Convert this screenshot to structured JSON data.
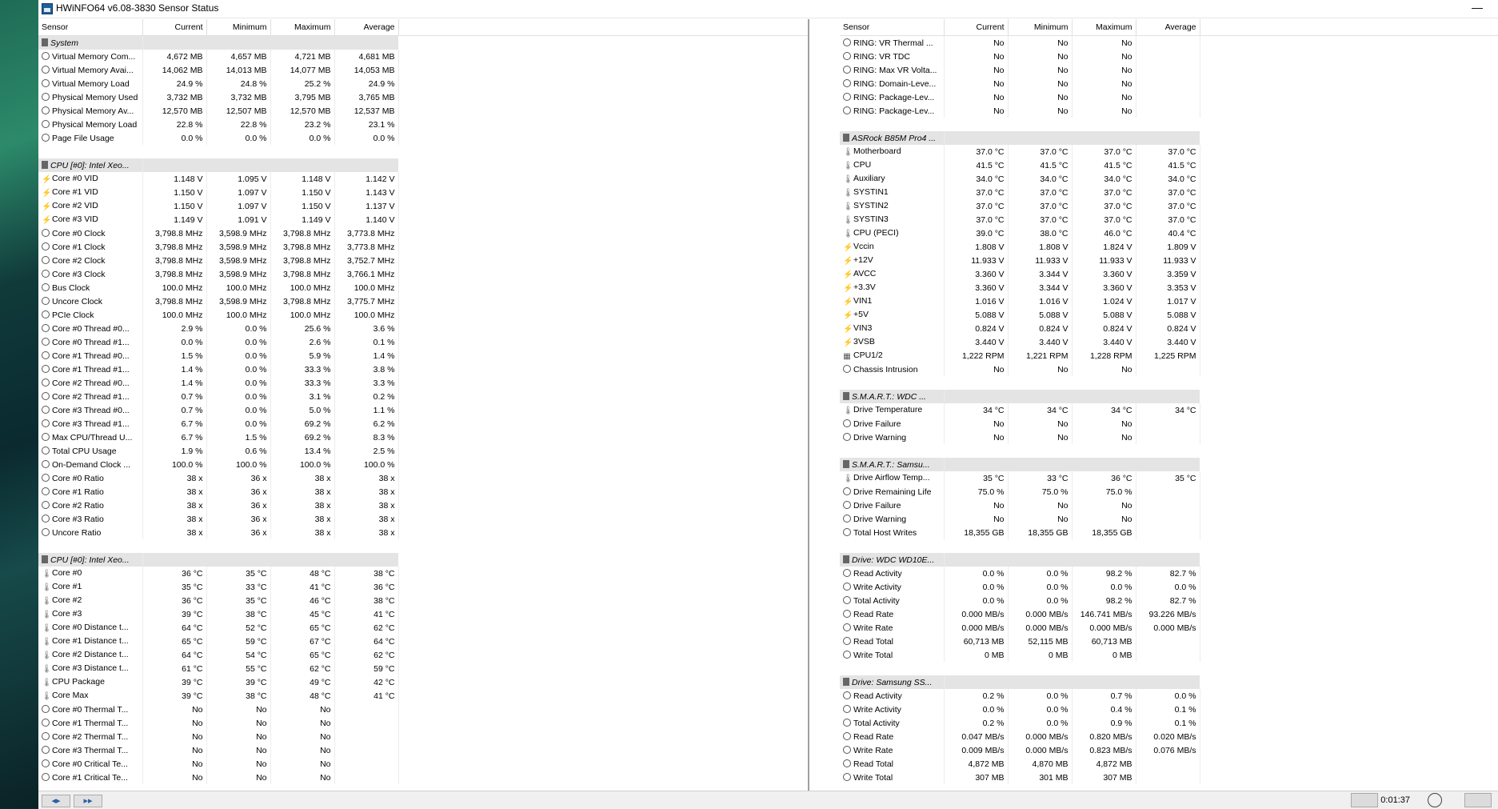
{
  "window": {
    "title": "HWiNFO64 v6.08-3830 Sensor Status",
    "minimize_label": "—"
  },
  "columns": {
    "sensor": "Sensor",
    "current": "Current",
    "minimum": "Minimum",
    "maximum": "Maximum",
    "average": "Average"
  },
  "left_panel": [
    {
      "type": "group",
      "name": "System"
    },
    {
      "type": "row",
      "icon": "clock",
      "name": "Virtual Memory Com...",
      "cur": "4,672 MB",
      "min": "4,657 MB",
      "max": "4,721 MB",
      "avg": "4,681 MB"
    },
    {
      "type": "row",
      "icon": "clock",
      "name": "Virtual Memory Avai...",
      "cur": "14,062 MB",
      "min": "14,013 MB",
      "max": "14,077 MB",
      "avg": "14,053 MB"
    },
    {
      "type": "row",
      "icon": "clock",
      "name": "Virtual Memory Load",
      "cur": "24.9 %",
      "min": "24.8 %",
      "max": "25.2 %",
      "avg": "24.9 %"
    },
    {
      "type": "row",
      "icon": "clock",
      "name": "Physical Memory Used",
      "cur": "3,732 MB",
      "min": "3,732 MB",
      "max": "3,795 MB",
      "avg": "3,765 MB"
    },
    {
      "type": "row",
      "icon": "clock",
      "name": "Physical Memory Av...",
      "cur": "12,570 MB",
      "min": "12,507 MB",
      "max": "12,570 MB",
      "avg": "12,537 MB"
    },
    {
      "type": "row",
      "icon": "clock",
      "name": "Physical Memory Load",
      "cur": "22.8 %",
      "min": "22.8 %",
      "max": "23.2 %",
      "avg": "23.1 %"
    },
    {
      "type": "row",
      "icon": "clock",
      "name": "Page File Usage",
      "cur": "0.0 %",
      "min": "0.0 %",
      "max": "0.0 %",
      "avg": "0.0 %"
    },
    {
      "type": "spacer"
    },
    {
      "type": "group",
      "name": "CPU [#0]: Intel Xeo..."
    },
    {
      "type": "row",
      "icon": "volt",
      "name": "Core #0 VID",
      "cur": "1.148 V",
      "min": "1.095 V",
      "max": "1.148 V",
      "avg": "1.142 V"
    },
    {
      "type": "row",
      "icon": "volt",
      "name": "Core #1 VID",
      "cur": "1.150 V",
      "min": "1.097 V",
      "max": "1.150 V",
      "avg": "1.143 V"
    },
    {
      "type": "row",
      "icon": "volt",
      "name": "Core #2 VID",
      "cur": "1.150 V",
      "min": "1.097 V",
      "max": "1.150 V",
      "avg": "1.137 V"
    },
    {
      "type": "row",
      "icon": "volt",
      "name": "Core #3 VID",
      "cur": "1.149 V",
      "min": "1.091 V",
      "max": "1.149 V",
      "avg": "1.140 V"
    },
    {
      "type": "row",
      "icon": "clock",
      "name": "Core #0 Clock",
      "cur": "3,798.8 MHz",
      "min": "3,598.9 MHz",
      "max": "3,798.8 MHz",
      "avg": "3,773.8 MHz"
    },
    {
      "type": "row",
      "icon": "clock",
      "name": "Core #1 Clock",
      "cur": "3,798.8 MHz",
      "min": "3,598.9 MHz",
      "max": "3,798.8 MHz",
      "avg": "3,773.8 MHz"
    },
    {
      "type": "row",
      "icon": "clock",
      "name": "Core #2 Clock",
      "cur": "3,798.8 MHz",
      "min": "3,598.9 MHz",
      "max": "3,798.8 MHz",
      "avg": "3,752.7 MHz"
    },
    {
      "type": "row",
      "icon": "clock",
      "name": "Core #3 Clock",
      "cur": "3,798.8 MHz",
      "min": "3,598.9 MHz",
      "max": "3,798.8 MHz",
      "avg": "3,766.1 MHz"
    },
    {
      "type": "row",
      "icon": "clock",
      "name": "Bus Clock",
      "cur": "100.0 MHz",
      "min": "100.0 MHz",
      "max": "100.0 MHz",
      "avg": "100.0 MHz"
    },
    {
      "type": "row",
      "icon": "clock",
      "name": "Uncore Clock",
      "cur": "3,798.8 MHz",
      "min": "3,598.9 MHz",
      "max": "3,798.8 MHz",
      "avg": "3,775.7 MHz"
    },
    {
      "type": "row",
      "icon": "clock",
      "name": "PCIe Clock",
      "cur": "100.0 MHz",
      "min": "100.0 MHz",
      "max": "100.0 MHz",
      "avg": "100.0 MHz"
    },
    {
      "type": "row",
      "icon": "clock",
      "name": "Core #0 Thread #0...",
      "cur": "2.9 %",
      "min": "0.0 %",
      "max": "25.6 %",
      "avg": "3.6 %"
    },
    {
      "type": "row",
      "icon": "clock",
      "name": "Core #0 Thread #1...",
      "cur": "0.0 %",
      "min": "0.0 %",
      "max": "2.6 %",
      "avg": "0.1 %"
    },
    {
      "type": "row",
      "icon": "clock",
      "name": "Core #1 Thread #0...",
      "cur": "1.5 %",
      "min": "0.0 %",
      "max": "5.9 %",
      "avg": "1.4 %"
    },
    {
      "type": "row",
      "icon": "clock",
      "name": "Core #1 Thread #1...",
      "cur": "1.4 %",
      "min": "0.0 %",
      "max": "33.3 %",
      "avg": "3.8 %"
    },
    {
      "type": "row",
      "icon": "clock",
      "name": "Core #2 Thread #0...",
      "cur": "1.4 %",
      "min": "0.0 %",
      "max": "33.3 %",
      "avg": "3.3 %"
    },
    {
      "type": "row",
      "icon": "clock",
      "name": "Core #2 Thread #1...",
      "cur": "0.7 %",
      "min": "0.0 %",
      "max": "3.1 %",
      "avg": "0.2 %"
    },
    {
      "type": "row",
      "icon": "clock",
      "name": "Core #3 Thread #0...",
      "cur": "0.7 %",
      "min": "0.0 %",
      "max": "5.0 %",
      "avg": "1.1 %"
    },
    {
      "type": "row",
      "icon": "clock",
      "name": "Core #3 Thread #1...",
      "cur": "6.7 %",
      "min": "0.0 %",
      "max": "69.2 %",
      "avg": "6.2 %"
    },
    {
      "type": "row",
      "icon": "clock",
      "name": "Max CPU/Thread U...",
      "cur": "6.7 %",
      "min": "1.5 %",
      "max": "69.2 %",
      "avg": "8.3 %"
    },
    {
      "type": "row",
      "icon": "clock",
      "name": "Total CPU Usage",
      "cur": "1.9 %",
      "min": "0.6 %",
      "max": "13.4 %",
      "avg": "2.5 %"
    },
    {
      "type": "row",
      "icon": "clock",
      "name": "On-Demand Clock ...",
      "cur": "100.0 %",
      "min": "100.0 %",
      "max": "100.0 %",
      "avg": "100.0 %"
    },
    {
      "type": "row",
      "icon": "clock",
      "name": "Core #0 Ratio",
      "cur": "38 x",
      "min": "36 x",
      "max": "38 x",
      "avg": "38 x"
    },
    {
      "type": "row",
      "icon": "clock",
      "name": "Core #1 Ratio",
      "cur": "38 x",
      "min": "36 x",
      "max": "38 x",
      "avg": "38 x"
    },
    {
      "type": "row",
      "icon": "clock",
      "name": "Core #2 Ratio",
      "cur": "38 x",
      "min": "36 x",
      "max": "38 x",
      "avg": "38 x"
    },
    {
      "type": "row",
      "icon": "clock",
      "name": "Core #3 Ratio",
      "cur": "38 x",
      "min": "36 x",
      "max": "38 x",
      "avg": "38 x"
    },
    {
      "type": "row",
      "icon": "clock",
      "name": "Uncore Ratio",
      "cur": "38 x",
      "min": "36 x",
      "max": "38 x",
      "avg": "38 x"
    },
    {
      "type": "spacer"
    },
    {
      "type": "group",
      "name": "CPU [#0]: Intel Xeo..."
    },
    {
      "type": "row",
      "icon": "temp",
      "name": "Core #0",
      "cur": "36 °C",
      "min": "35 °C",
      "max": "48 °C",
      "avg": "38 °C"
    },
    {
      "type": "row",
      "icon": "temp",
      "name": "Core #1",
      "cur": "35 °C",
      "min": "33 °C",
      "max": "41 °C",
      "avg": "36 °C"
    },
    {
      "type": "row",
      "icon": "temp",
      "name": "Core #2",
      "cur": "36 °C",
      "min": "35 °C",
      "max": "46 °C",
      "avg": "38 °C"
    },
    {
      "type": "row",
      "icon": "temp",
      "name": "Core #3",
      "cur": "39 °C",
      "min": "38 °C",
      "max": "45 °C",
      "avg": "41 °C"
    },
    {
      "type": "row",
      "icon": "temp",
      "name": "Core #0 Distance t...",
      "cur": "64 °C",
      "min": "52 °C",
      "max": "65 °C",
      "avg": "62 °C"
    },
    {
      "type": "row",
      "icon": "temp",
      "name": "Core #1 Distance t...",
      "cur": "65 °C",
      "min": "59 °C",
      "max": "67 °C",
      "avg": "64 °C"
    },
    {
      "type": "row",
      "icon": "temp",
      "name": "Core #2 Distance t...",
      "cur": "64 °C",
      "min": "54 °C",
      "max": "65 °C",
      "avg": "62 °C"
    },
    {
      "type": "row",
      "icon": "temp",
      "name": "Core #3 Distance t...",
      "cur": "61 °C",
      "min": "55 °C",
      "max": "62 °C",
      "avg": "59 °C"
    },
    {
      "type": "row",
      "icon": "temp",
      "name": "CPU Package",
      "cur": "39 °C",
      "min": "39 °C",
      "max": "49 °C",
      "avg": "42 °C"
    },
    {
      "type": "row",
      "icon": "temp",
      "name": "Core Max",
      "cur": "39 °C",
      "min": "38 °C",
      "max": "48 °C",
      "avg": "41 °C"
    },
    {
      "type": "row",
      "icon": "clock",
      "name": "Core #0 Thermal T...",
      "cur": "No",
      "min": "No",
      "max": "No",
      "avg": ""
    },
    {
      "type": "row",
      "icon": "clock",
      "name": "Core #1 Thermal T...",
      "cur": "No",
      "min": "No",
      "max": "No",
      "avg": ""
    },
    {
      "type": "row",
      "icon": "clock",
      "name": "Core #2 Thermal T...",
      "cur": "No",
      "min": "No",
      "max": "No",
      "avg": ""
    },
    {
      "type": "row",
      "icon": "clock",
      "name": "Core #3 Thermal T...",
      "cur": "No",
      "min": "No",
      "max": "No",
      "avg": ""
    },
    {
      "type": "row",
      "icon": "clock",
      "name": "Core #0 Critical Te...",
      "cur": "No",
      "min": "No",
      "max": "No",
      "avg": ""
    },
    {
      "type": "row",
      "icon": "clock",
      "name": "Core #1 Critical Te...",
      "cur": "No",
      "min": "No",
      "max": "No",
      "avg": ""
    }
  ],
  "right_panel": [
    {
      "type": "row",
      "icon": "clock",
      "name": "RING: VR Thermal ...",
      "cur": "No",
      "min": "No",
      "max": "No",
      "avg": ""
    },
    {
      "type": "row",
      "icon": "clock",
      "name": "RING: VR TDC",
      "cur": "No",
      "min": "No",
      "max": "No",
      "avg": ""
    },
    {
      "type": "row",
      "icon": "clock",
      "name": "RING: Max VR Volta...",
      "cur": "No",
      "min": "No",
      "max": "No",
      "avg": ""
    },
    {
      "type": "row",
      "icon": "clock",
      "name": "RING: Domain-Leve...",
      "cur": "No",
      "min": "No",
      "max": "No",
      "avg": ""
    },
    {
      "type": "row",
      "icon": "clock",
      "name": "RING: Package-Lev...",
      "cur": "No",
      "min": "No",
      "max": "No",
      "avg": ""
    },
    {
      "type": "row",
      "icon": "clock",
      "name": "RING: Package-Lev...",
      "cur": "No",
      "min": "No",
      "max": "No",
      "avg": ""
    },
    {
      "type": "spacer"
    },
    {
      "type": "group",
      "name": "ASRock B85M Pro4 ..."
    },
    {
      "type": "row",
      "icon": "temp",
      "name": "Motherboard",
      "cur": "37.0 °C",
      "min": "37.0 °C",
      "max": "37.0 °C",
      "avg": "37.0 °C"
    },
    {
      "type": "row",
      "icon": "temp",
      "name": "CPU",
      "cur": "41.5 °C",
      "min": "41.5 °C",
      "max": "41.5 °C",
      "avg": "41.5 °C"
    },
    {
      "type": "row",
      "icon": "temp",
      "name": "Auxiliary",
      "cur": "34.0 °C",
      "min": "34.0 °C",
      "max": "34.0 °C",
      "avg": "34.0 °C"
    },
    {
      "type": "row",
      "icon": "temp",
      "name": "SYSTIN1",
      "cur": "37.0 °C",
      "min": "37.0 °C",
      "max": "37.0 °C",
      "avg": "37.0 °C"
    },
    {
      "type": "row",
      "icon": "temp",
      "name": "SYSTIN2",
      "cur": "37.0 °C",
      "min": "37.0 °C",
      "max": "37.0 °C",
      "avg": "37.0 °C"
    },
    {
      "type": "row",
      "icon": "temp",
      "name": "SYSTIN3",
      "cur": "37.0 °C",
      "min": "37.0 °C",
      "max": "37.0 °C",
      "avg": "37.0 °C"
    },
    {
      "type": "row",
      "icon": "temp",
      "name": "CPU (PECI)",
      "cur": "39.0 °C",
      "min": "38.0 °C",
      "max": "46.0 °C",
      "avg": "40.4 °C"
    },
    {
      "type": "row",
      "icon": "volt",
      "name": "Vccin",
      "cur": "1.808 V",
      "min": "1.808 V",
      "max": "1.824 V",
      "avg": "1.809 V"
    },
    {
      "type": "row",
      "icon": "volt",
      "name": "+12V",
      "cur": "11.933 V",
      "min": "11.933 V",
      "max": "11.933 V",
      "avg": "11.933 V"
    },
    {
      "type": "row",
      "icon": "volt",
      "name": "AVCC",
      "cur": "3.360 V",
      "min": "3.344 V",
      "max": "3.360 V",
      "avg": "3.359 V"
    },
    {
      "type": "row",
      "icon": "volt",
      "name": "+3.3V",
      "cur": "3.360 V",
      "min": "3.344 V",
      "max": "3.360 V",
      "avg": "3.353 V"
    },
    {
      "type": "row",
      "icon": "volt",
      "name": "VIN1",
      "cur": "1.016 V",
      "min": "1.016 V",
      "max": "1.024 V",
      "avg": "1.017 V"
    },
    {
      "type": "row",
      "icon": "volt",
      "name": "+5V",
      "cur": "5.088 V",
      "min": "5.088 V",
      "max": "5.088 V",
      "avg": "5.088 V"
    },
    {
      "type": "row",
      "icon": "volt",
      "name": "VIN3",
      "cur": "0.824 V",
      "min": "0.824 V",
      "max": "0.824 V",
      "avg": "0.824 V"
    },
    {
      "type": "row",
      "icon": "volt",
      "name": "3VSB",
      "cur": "3.440 V",
      "min": "3.440 V",
      "max": "3.440 V",
      "avg": "3.440 V"
    },
    {
      "type": "row",
      "icon": "fan",
      "name": "CPU1/2",
      "cur": "1,222 RPM",
      "min": "1,221 RPM",
      "max": "1,228 RPM",
      "avg": "1,225 RPM"
    },
    {
      "type": "row",
      "icon": "clock",
      "name": "Chassis Intrusion",
      "cur": "No",
      "min": "No",
      "max": "No",
      "avg": ""
    },
    {
      "type": "spacer"
    },
    {
      "type": "group",
      "name": "S.M.A.R.T.: WDC ..."
    },
    {
      "type": "row",
      "icon": "temp",
      "name": "Drive Temperature",
      "cur": "34 °C",
      "min": "34 °C",
      "max": "34 °C",
      "avg": "34 °C"
    },
    {
      "type": "row",
      "icon": "clock",
      "name": "Drive Failure",
      "cur": "No",
      "min": "No",
      "max": "No",
      "avg": ""
    },
    {
      "type": "row",
      "icon": "clock",
      "name": "Drive Warning",
      "cur": "No",
      "min": "No",
      "max": "No",
      "avg": ""
    },
    {
      "type": "spacer"
    },
    {
      "type": "group",
      "name": "S.M.A.R.T.: Samsu..."
    },
    {
      "type": "row",
      "icon": "temp",
      "name": "Drive Airflow Temp...",
      "cur": "35 °C",
      "min": "33 °C",
      "max": "36 °C",
      "avg": "35 °C"
    },
    {
      "type": "row",
      "icon": "clock",
      "name": "Drive Remaining Life",
      "cur": "75.0 %",
      "min": "75.0 %",
      "max": "75.0 %",
      "avg": ""
    },
    {
      "type": "row",
      "icon": "clock",
      "name": "Drive Failure",
      "cur": "No",
      "min": "No",
      "max": "No",
      "avg": ""
    },
    {
      "type": "row",
      "icon": "clock",
      "name": "Drive Warning",
      "cur": "No",
      "min": "No",
      "max": "No",
      "avg": ""
    },
    {
      "type": "row",
      "icon": "clock",
      "name": "Total Host Writes",
      "cur": "18,355 GB",
      "min": "18,355 GB",
      "max": "18,355 GB",
      "avg": ""
    },
    {
      "type": "spacer"
    },
    {
      "type": "group",
      "name": "Drive: WDC WD10E..."
    },
    {
      "type": "row",
      "icon": "clock",
      "name": "Read Activity",
      "cur": "0.0 %",
      "min": "0.0 %",
      "max": "98.2 %",
      "avg": "82.7 %"
    },
    {
      "type": "row",
      "icon": "clock",
      "name": "Write Activity",
      "cur": "0.0 %",
      "min": "0.0 %",
      "max": "0.0 %",
      "avg": "0.0 %"
    },
    {
      "type": "row",
      "icon": "clock",
      "name": "Total Activity",
      "cur": "0.0 %",
      "min": "0.0 %",
      "max": "98.2 %",
      "avg": "82.7 %"
    },
    {
      "type": "row",
      "icon": "clock",
      "name": "Read Rate",
      "cur": "0.000 MB/s",
      "min": "0.000 MB/s",
      "max": "146.741 MB/s",
      "avg": "93.226 MB/s"
    },
    {
      "type": "row",
      "icon": "clock",
      "name": "Write Rate",
      "cur": "0.000 MB/s",
      "min": "0.000 MB/s",
      "max": "0.000 MB/s",
      "avg": "0.000 MB/s"
    },
    {
      "type": "row",
      "icon": "clock",
      "name": "Read Total",
      "cur": "60,713 MB",
      "min": "52,115 MB",
      "max": "60,713 MB",
      "avg": ""
    },
    {
      "type": "row",
      "icon": "clock",
      "name": "Write Total",
      "cur": "0 MB",
      "min": "0 MB",
      "max": "0 MB",
      "avg": ""
    },
    {
      "type": "spacer"
    },
    {
      "type": "group",
      "name": "Drive: Samsung SS..."
    },
    {
      "type": "row",
      "icon": "clock",
      "name": "Read Activity",
      "cur": "0.2 %",
      "min": "0.0 %",
      "max": "0.7 %",
      "avg": "0.0 %"
    },
    {
      "type": "row",
      "icon": "clock",
      "name": "Write Activity",
      "cur": "0.0 %",
      "min": "0.0 %",
      "max": "0.4 %",
      "avg": "0.1 %"
    },
    {
      "type": "row",
      "icon": "clock",
      "name": "Total Activity",
      "cur": "0.2 %",
      "min": "0.0 %",
      "max": "0.9 %",
      "avg": "0.1 %"
    },
    {
      "type": "row",
      "icon": "clock",
      "name": "Read Rate",
      "cur": "0.047 MB/s",
      "min": "0.000 MB/s",
      "max": "0.820 MB/s",
      "avg": "0.020 MB/s"
    },
    {
      "type": "row",
      "icon": "clock",
      "name": "Write Rate",
      "cur": "0.009 MB/s",
      "min": "0.000 MB/s",
      "max": "0.823 MB/s",
      "avg": "0.076 MB/s"
    },
    {
      "type": "row",
      "icon": "clock",
      "name": "Read Total",
      "cur": "4,872 MB",
      "min": "4,870 MB",
      "max": "4,872 MB",
      "avg": ""
    },
    {
      "type": "row",
      "icon": "clock",
      "name": "Write Total",
      "cur": "307 MB",
      "min": "301 MB",
      "max": "307 MB",
      "avg": ""
    }
  ],
  "statusbar": {
    "nav_back_label": "◂▸",
    "nav_fwd_label": "▸▸",
    "timer": "0:01:37"
  }
}
